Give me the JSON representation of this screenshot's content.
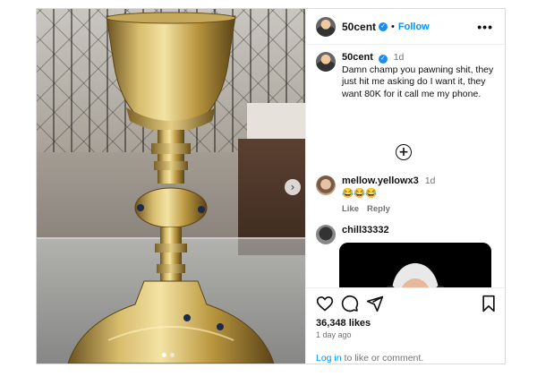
{
  "post": {
    "username": "50cent",
    "follow_label": "Follow",
    "separator": "•",
    "more_label": "•••",
    "verified_mark": "✓"
  },
  "caption": {
    "username": "50cent",
    "time": "1d",
    "text": "Damn champ you pawning shit, they just hit me asking do I want it, they want 80K for it call me my phone."
  },
  "load_more_icon": "+",
  "comments": [
    {
      "username": "mellow.yellowx3",
      "time": "1d",
      "text": "😂😂😂",
      "like_label": "Like",
      "reply_label": "Reply"
    },
    {
      "username": "chill33332"
    }
  ],
  "footer": {
    "likes": "36,348 likes",
    "time_ago": "1 day ago",
    "login_link": "Log in",
    "login_rest": " to like or comment."
  },
  "carousel": {
    "next_icon": "›"
  },
  "icons": {
    "like": "heart-icon",
    "comment": "comment-icon",
    "share": "share-icon",
    "save": "bookmark-icon",
    "next": "chevron-right-icon",
    "load_more": "plus-circle-icon"
  },
  "colors": {
    "accent": "#0095f6",
    "verified": "#1a8cf0",
    "muted": "#737373",
    "border": "#dbdbdb"
  }
}
